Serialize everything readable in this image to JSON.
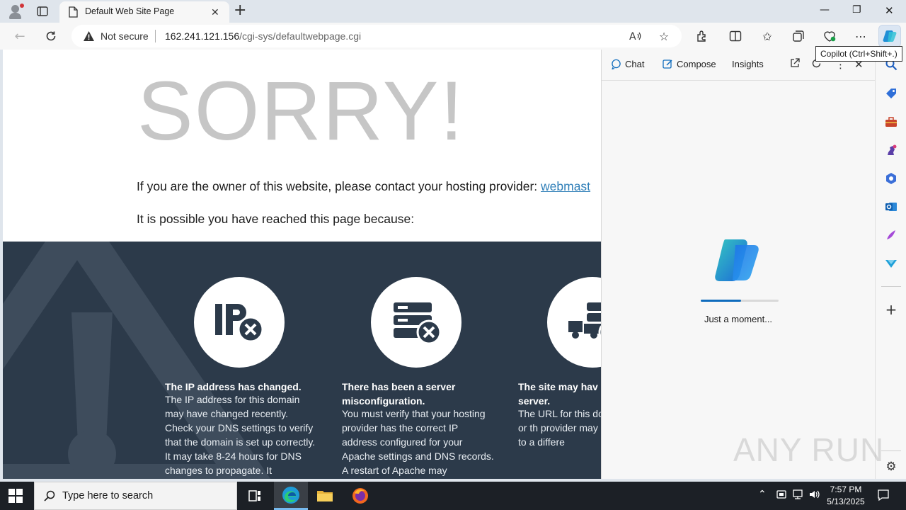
{
  "browser": {
    "tab_title": "Default Web Site Page",
    "security_label": "Not secure",
    "url_host": "162.241.121.156",
    "url_path": "/cgi-sys/defaultwebpage.cgi",
    "copilot_tooltip": "Copilot (Ctrl+Shift+.)"
  },
  "page": {
    "headline": "SORRY!",
    "owner_text": "If you are the owner of this website, please contact your hosting provider: ",
    "owner_link": "webmast",
    "possible_text": "It is possible you have reached this page because:",
    "reasons": [
      {
        "title": "The IP address has changed.",
        "body": "The IP address for this domain may have changed recently. Check your DNS settings to verify that the domain is set up correctly. It may take 8-24 hours for DNS changes to propagate. It"
      },
      {
        "title": "There has been a server misconfiguration.",
        "body": "You must verify that your hosting provider has the correct IP address configured for your Apache settings and DNS records. A restart of Apache may"
      },
      {
        "title": "The site may hav different server.",
        "body": "The URL for this do have changed or th provider may have account to a differe"
      }
    ]
  },
  "copilot": {
    "tabs": [
      "Chat",
      "Compose",
      "Insights"
    ],
    "loading_text": "Just a moment...",
    "progress": 0.52
  },
  "watermark": "ANY RUN",
  "taskbar": {
    "search_placeholder": "Type here to search",
    "time": "7:57 PM",
    "date": "5/13/2025"
  },
  "colors": {
    "dark_band": "#2c3a4a",
    "link": "#2f7fb8",
    "headline": "#c6c6c6",
    "accent": "#0f6cbd"
  }
}
